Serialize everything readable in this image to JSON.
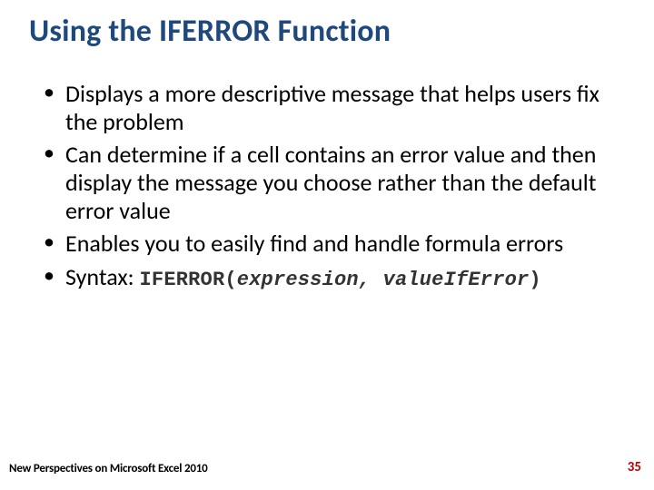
{
  "title": "Using the IFERROR Function",
  "bullets": [
    "Displays a more descriptive message that helps users fix the problem",
    "Can determine if a cell contains an error value and then display the message you choose rather than the default error value",
    "Enables you to easily find and handle formula errors"
  ],
  "syntax_label": "Syntax:",
  "syntax_func": "IFERROR(",
  "syntax_args": "expression, valueIfError",
  "syntax_close": ")",
  "footer_left": "New Perspectives on Microsoft Excel 2010",
  "footer_right": "35"
}
